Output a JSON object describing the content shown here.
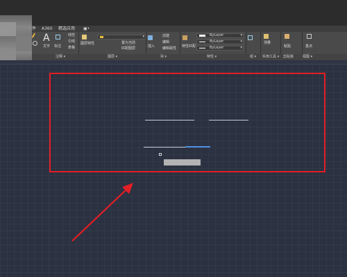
{
  "tabs": [
    "插件",
    "A360",
    "精选应用",
    "▣•"
  ],
  "ribbon": {
    "annotate": {
      "text_label": "文字",
      "dimension_label": "标注",
      "leader_label": "引线",
      "table_label": "表格",
      "linear_label": "线性",
      "a_glyph": "A"
    },
    "layers": {
      "layer_props_label": "图层特性",
      "make_current_label": "置为当前",
      "match_label": "匹配图层"
    },
    "block": {
      "insert_label": "插入",
      "create_label": "创建",
      "edit_label": "编辑",
      "edit_attr_label": "编辑属性"
    },
    "properties": {
      "match_label": "特性匹配",
      "by_layer_1": "ByLayer",
      "by_layer_2": "ByLayer",
      "by_layer_3": "ByLayer"
    },
    "utilities": {
      "measure_label": "测量"
    },
    "clipboard": {
      "paste_label": "粘贴"
    },
    "view": {
      "base_label": "基点"
    }
  },
  "panel_titles": {
    "annotate": "注释 ▾",
    "layers": "图层 ▾",
    "block": "块 ▾",
    "properties": "特性 ▾",
    "groups": "组 ▾",
    "utilities": "实用工具 ▾",
    "clipboard": "剪贴板",
    "view": "视图 ▾"
  },
  "colors": {
    "highlight": "#e41e25",
    "canvas_bg": "#2b3140",
    "arrow": "#e41e25"
  }
}
